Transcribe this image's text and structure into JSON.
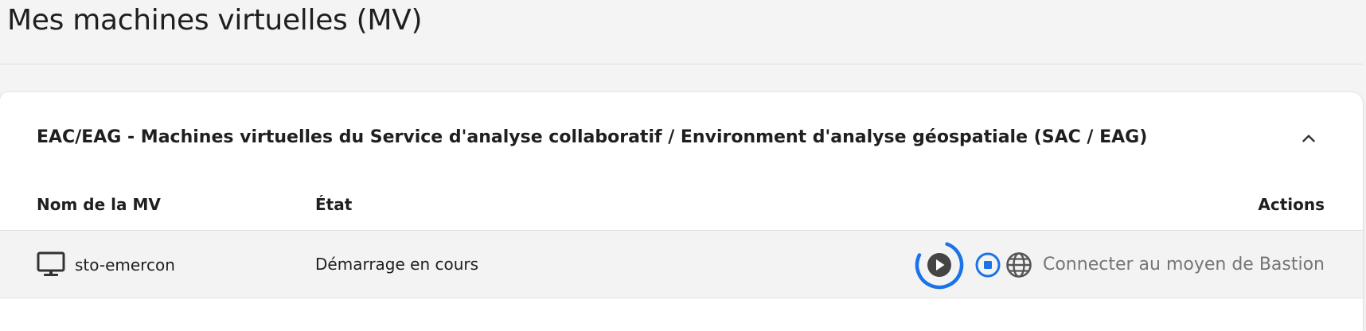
{
  "page": {
    "title": "Mes machines virtuelles (MV)"
  },
  "section": {
    "title": "EAC/EAG - Machines virtuelles du Service d'analyse collaboratif / Environment d'analyse géospatiale (SAC / EAG)",
    "expanded": true
  },
  "table": {
    "columns": {
      "name": "Nom de la MV",
      "state": "État",
      "actions": "Actions"
    },
    "rows": [
      {
        "name": "sto-emercon",
        "state": "Démarrage en cours",
        "connect_label": "Connecter au moyen de Bastion"
      }
    ]
  },
  "icons": {
    "vm": "monitor-icon",
    "collapse": "chevron-up-icon",
    "start": "play-circle-icon",
    "stop": "stop-circle-icon",
    "connect": "globe-icon"
  },
  "colors": {
    "accent": "#1a73e8",
    "text": "#1f1f1f",
    "muted": "#757575",
    "icon_dark": "#444444"
  }
}
